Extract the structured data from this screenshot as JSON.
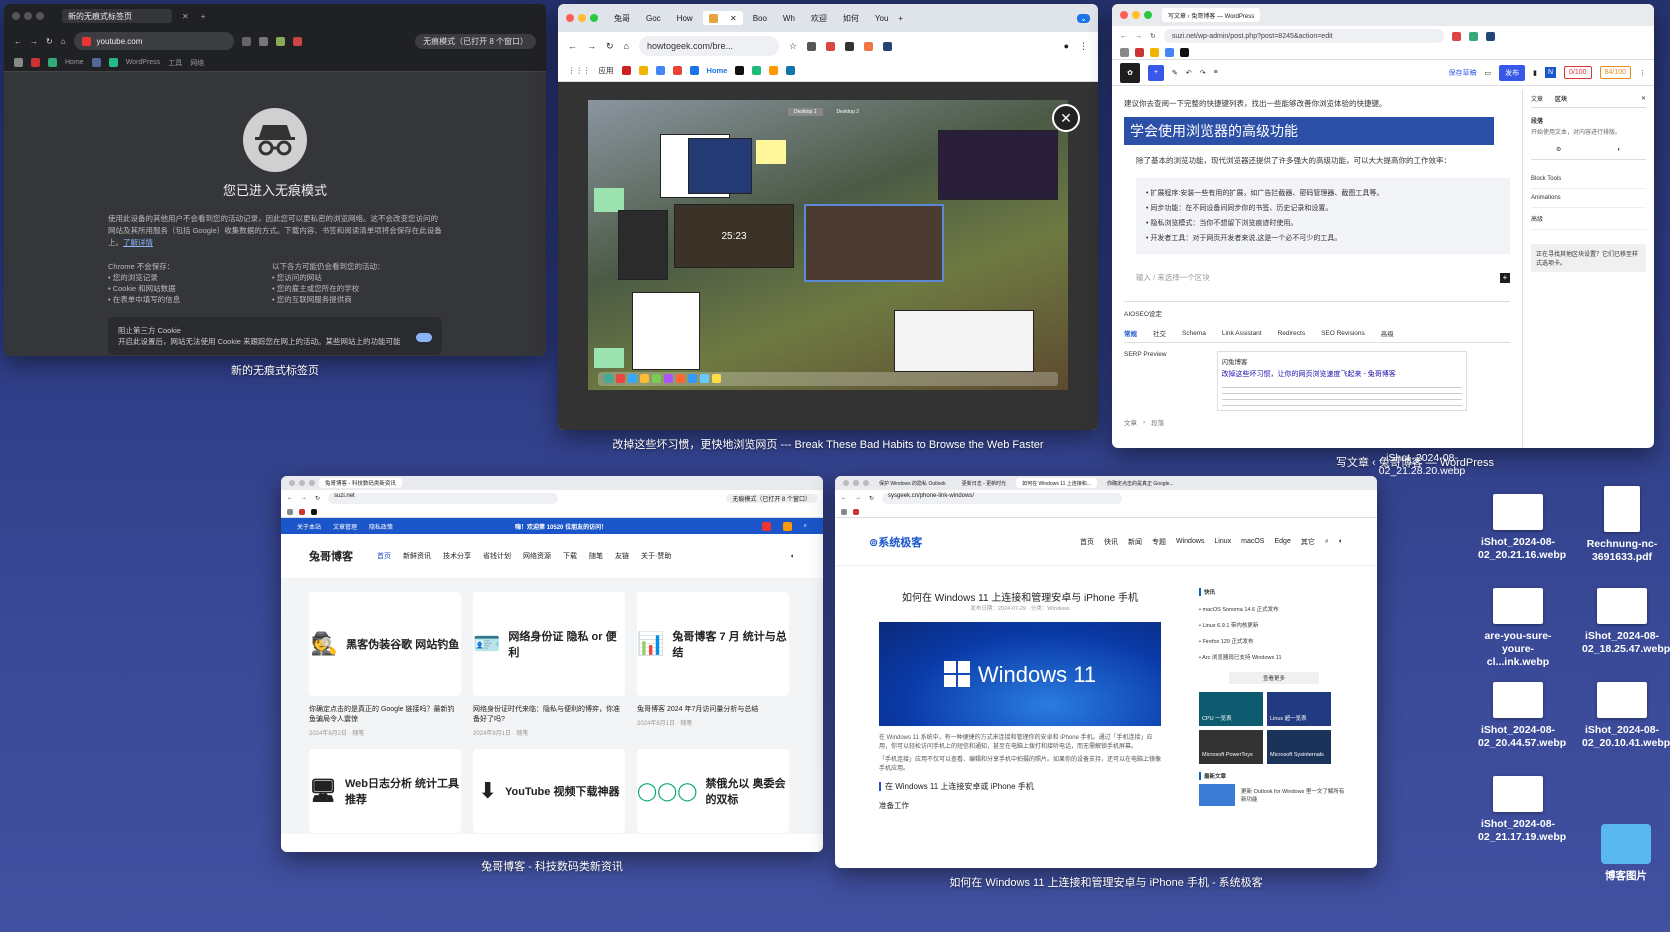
{
  "windows": {
    "incognito": {
      "tab": "新的无痕式标签页",
      "url": "youtube.com",
      "badge": "无痕模式（已打开 8 个窗口）",
      "bookmarks": [
        "Home",
        "WordPress",
        "工具",
        "网络"
      ],
      "heading": "您已进入无痕模式",
      "intro": "使用此设备的其他用户不会看到您的活动记录，因此您可以更私密的浏览网络。这不会改变您访问的网站及其所用服务（包括 Google）收集数据的方式。下载内容、书签和阅读清单项将会保存在此设备上。",
      "learn_more": "了解详情",
      "left_title": "Chrome 不会保存：",
      "left_items": [
        "您的浏览记录",
        "Cookie 和网站数据",
        "在表单中填写的信息"
      ],
      "right_title": "以下各方可能仍会看到您的活动：",
      "right_items": [
        "您访问的网站",
        "您的雇主或您所在的学校",
        "您的互联网服务提供商"
      ],
      "cookie_title": "阻止第三方 Cookie",
      "cookie_text": "开启此设置后，网站无法使用 Cookie 来跟踪您在网上的活动。某些网站上的功能可能会无法正常使用。",
      "caption": "新的无痕式标签页"
    },
    "howtogeek": {
      "tabs": [
        "兔哥",
        "Goc",
        "How",
        "",
        "Boo",
        "Wh",
        "欢迎",
        "如何",
        "You"
      ],
      "url": "howtogeek.com/bre...",
      "bookmarks": [
        "应用",
        "Home"
      ],
      "mini_labels": [
        "Desktop 1",
        "Desktop 2"
      ],
      "clock": "25:23",
      "caption": "改掉这些坏习惯，更快地浏览网页 --- Break These Bad Habits to Browse the Web Faster"
    },
    "wordpress": {
      "tab": "写文章 ‹ 兔哥博客 — WordPress",
      "url": "suzi.net/wp-admin/post.php?post=8245&action=edit",
      "intro_line": "建议你去查阅一下完整的快捷键列表，找出一些能够改善你浏览体验的快捷键。",
      "heading": "学会使用浏览器的高级功能",
      "para": "除了基本的浏览功能，现代浏览器还提供了许多强大的高级功能，可以大大提高你的工作效率：",
      "bullets": [
        "扩展程序:安装一些有用的扩展，如广告拦截器、密码管理器、截图工具等。",
        "同步功能：在不同设备间同步你的书签、历史记录和设置。",
        "隐私浏览模式：当你不想留下浏览痕迹时使用。",
        "开发者工具：对于网页开发者来说,这是一个必不可少的工具。"
      ],
      "placeholder": "输入 / 来选择一个区块",
      "aioseo": "AIOSEO设定",
      "seo_tabs": [
        "常规",
        "社交",
        "Schema",
        "Link Assistant",
        "Redirects",
        "SEO Revisions",
        "高级"
      ],
      "serp": "SERP Preview",
      "serp_site": "闪兔博客",
      "serp_title": "改掉这些坏习惯，让你的网页浏览速度飞起来 - 兔哥博客",
      "side_tabs": [
        "文章",
        "区块"
      ],
      "side_block": "段落",
      "side_desc": "开始使用文本，对内容进行排版。",
      "side_items": [
        "Block Tools",
        "Animations",
        "高级"
      ],
      "side_note": "正在寻找其他区块设置？它们已移至样式选项卡。",
      "save": "保存草稿",
      "publish": "发布",
      "score": "0/100",
      "score2": "84/100",
      "crumbs": [
        "文章",
        "段落"
      ],
      "caption": "写文章 ‹ 兔哥博客 — WordPress"
    },
    "tuge": {
      "tab": "兔哥博客 - 科技数码类新资讯",
      "url": "suzi.net",
      "badge": "无痕模式（已打开 8 个窗口）",
      "topbar": [
        "关于本站",
        "文章管理",
        "隐私政策"
      ],
      "welcome": "嗨！欢迎第 10520 位朋友的访问！",
      "site": "兔哥博客",
      "nav": [
        "首页",
        "新鲜资讯",
        "技术分享",
        "省钱计划",
        "网络资源",
        "下载",
        "随笔",
        "友链",
        "关于·赞助"
      ],
      "cards": [
        {
          "thumb": "黑客伪装谷歌 网站钓鱼",
          "title": "你确定点击的是真正的 Google 链接吗？最新钓鱼骗局令人震惊",
          "meta": "2024年8月2日 · 随笔"
        },
        {
          "thumb": "网络身份证 隐私 or 便利",
          "title": "网络身份证时代来临：隐私与便利的博弈，你准备好了吗?",
          "meta": "2024年8月1日 · 随笔"
        },
        {
          "thumb": "兔哥博客 7 月 统计与总结",
          "title": "兔哥博客 2024 年7月访问量分析与总结",
          "meta": "2024年8月1日 · 随笔"
        },
        {
          "thumb": "Web日志分析 统计工具推荐",
          "title": "",
          "meta": ""
        },
        {
          "thumb": "YouTube 视频下载神器",
          "title": "",
          "meta": ""
        },
        {
          "thumb": "禁俄允以 奥委会的双标",
          "title": "",
          "meta": ""
        }
      ],
      "caption": "兔哥博客 - 科技数码类新资讯"
    },
    "sysgeek": {
      "tabs": [
        "保护 Windows 的隐私 Outlook",
        "更新日志 - 更新时光",
        "如何在 Windows 11 上连接和...",
        "你确定点击的是真正 Google..."
      ],
      "url": "sysgeek.cn/phone-link-windows/",
      "logo": "系统极客",
      "nav": [
        "首页",
        "快讯",
        "新闻",
        "专题",
        "Windows",
        "Linux",
        "macOS",
        "Edge",
        "其它"
      ],
      "title": "如何在 Windows 11 上连接和管理安卓与 iPhone 手机",
      "meta": "发布日期：2024-07-29 · 分类：Windows",
      "hero": "Windows 11",
      "p1": "在 Windows 11 系统中，有一种便捷的方式来连接和管理你的安卓和 iPhone 手机。通过「手机连接」应用，你可以轻松访问手机上的短信和通知，甚至在电脑上拨打和接听电话，而无需解锁手机屏幕。",
      "p2": "「手机连接」应用不仅可以查看、编辑和分享手机中拍摄的照片。如果你的设备支持，还可以在电脑上镜像手机应用。",
      "h2": "在 Windows 11 上连接安卓或 iPhone 手机",
      "h3": "准备工作",
      "side_title": "快讯",
      "news": [
        "macOS Sonoma 14.6 正式发布",
        "Linux 6.9.1 带内核更新",
        "Firefox 129 正式发布",
        "Arc 浏览器现已支持 Windows 11"
      ],
      "more": "查看更多",
      "tiles": [
        "CPU 一览表",
        "Linux 超一览表",
        "Microsoft PowerToys",
        "Microsoft Sysinternals"
      ],
      "latest": "最新文章",
      "latest_item": "更新 Outlook for Windows 里一文了解所有新功能",
      "caption": "如何在 Windows 11 上连接和管理安卓与 iPhone 手机 - 系统极客"
    }
  },
  "desktop": {
    "items": [
      {
        "label": "iShot_2024-08-02_21.28.20.webp"
      },
      {
        "label": "iShot_2024-08-02_20.21.16.webp"
      },
      {
        "label": "Rechnung-nc-3691633.pdf"
      },
      {
        "label": "are-you-sure-youre-cl...ink.webp"
      },
      {
        "label": "iShot_2024-08-02_18.25.47.webp"
      },
      {
        "label": "iShot_2024-08-02_20.44.57.webp"
      },
      {
        "label": "iShot_2024-08-02_20.10.41.webp"
      },
      {
        "label": "iShot_2024-08-02_21.17.19.webp"
      },
      {
        "label": "博客图片"
      }
    ]
  },
  "colors": {
    "accent_blue": "#1a56c9",
    "wp_heading": "#2c4fa8",
    "desktop_bg": "#2e3c84"
  }
}
